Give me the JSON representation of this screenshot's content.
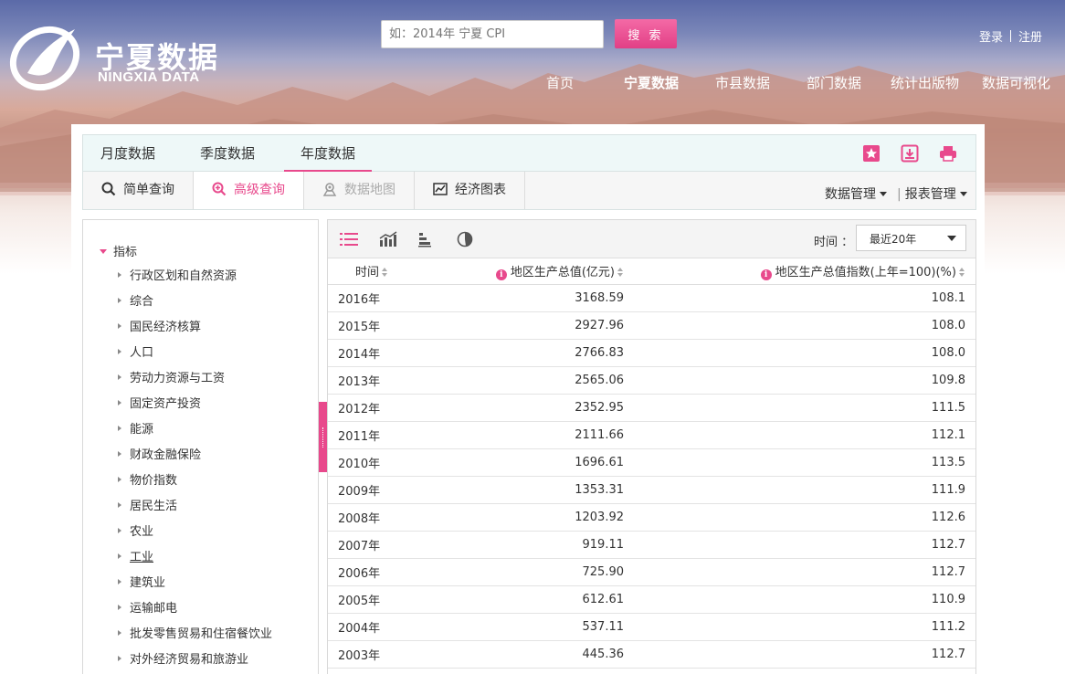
{
  "site": {
    "name_cn": "宁夏数据",
    "name_en": "NINGXIA DATA"
  },
  "search": {
    "placeholder": "如：2014年 宁夏 CPI",
    "button_label": "搜 索"
  },
  "auth": {
    "login": "登录",
    "register": "注册"
  },
  "top_nav": [
    {
      "label": "首页",
      "active": false
    },
    {
      "label": "宁夏数据",
      "active": true
    },
    {
      "label": "市县数据",
      "active": false
    },
    {
      "label": "部门数据",
      "active": false
    },
    {
      "label": "统计出版物",
      "active": false
    },
    {
      "label": "数据可视化",
      "active": false
    }
  ],
  "period_tabs": [
    {
      "label": "月度数据",
      "active": false
    },
    {
      "label": "季度数据",
      "active": false
    },
    {
      "label": "年度数据",
      "active": true
    }
  ],
  "tab_icons": [
    "star-icon",
    "download-icon",
    "print-icon"
  ],
  "query_tools": [
    {
      "label": "简单查询",
      "icon": "search-icon",
      "state": "normal"
    },
    {
      "label": "高级查询",
      "icon": "zoom-plus-icon",
      "state": "active"
    },
    {
      "label": "数据地图",
      "icon": "map-pin-icon",
      "state": "disabled"
    },
    {
      "label": "经济图表",
      "icon": "chart-icon",
      "state": "normal"
    }
  ],
  "management": {
    "data_mgmt": "数据管理",
    "report_mgmt": "报表管理"
  },
  "sidebar": {
    "root_label": "指标",
    "items": [
      "行政区划和自然资源",
      "综合",
      "国民经济核算",
      "人口",
      "劳动力资源与工资",
      "固定资产投资",
      "能源",
      "财政金融保险",
      "物价指数",
      "居民生活",
      "农业",
      "工业",
      "建筑业",
      "运输邮电",
      "批发零售贸易和住宿餐饮业",
      "对外经济贸易和旅游业"
    ]
  },
  "view_icons": [
    "list-view-icon",
    "line-chart-icon",
    "bar-chart-icon",
    "pie-chart-icon"
  ],
  "time_filter": {
    "label": "时间 ：",
    "selected": "最近20年"
  },
  "table": {
    "headers": [
      "时间",
      "地区生产总值(亿元)",
      "地区生产总值指数(上年=100)(%)"
    ],
    "rows": [
      [
        "2016年",
        "3168.59",
        "108.1"
      ],
      [
        "2015年",
        "2927.96",
        "108.0"
      ],
      [
        "2014年",
        "2766.83",
        "108.0"
      ],
      [
        "2013年",
        "2565.06",
        "109.8"
      ],
      [
        "2012年",
        "2352.95",
        "111.5"
      ],
      [
        "2011年",
        "2111.66",
        "112.1"
      ],
      [
        "2010年",
        "1696.61",
        "113.5"
      ],
      [
        "2009年",
        "1353.31",
        "111.9"
      ],
      [
        "2008年",
        "1203.92",
        "112.6"
      ],
      [
        "2007年",
        "919.11",
        "112.7"
      ],
      [
        "2006年",
        "725.90",
        "112.7"
      ],
      [
        "2005年",
        "612.61",
        "110.9"
      ],
      [
        "2004年",
        "537.11",
        "111.2"
      ],
      [
        "2003年",
        "445.36",
        "112.7"
      ]
    ]
  },
  "colors": {
    "accent": "#e8498c",
    "tab_bg": "#eef8f8",
    "toolbar_bg": "#f6f6f6"
  }
}
